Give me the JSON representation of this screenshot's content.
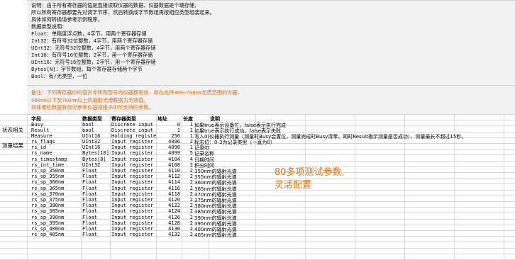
{
  "note_box": {
    "lines": [
      "说明：由于所有寄存器的值是直接读取仪器的数据，仪器数据是个端存储，",
      "所以所有寄存器都要先对调字节序，然后转换成字节数组再按相应类型组装起来。",
      "具体如何转换请参考示例程序。",
      "数据类型说明：",
      "Float：单精度浮点数，4字节，用两个寄存器存储",
      "Int32：有符号32位整数，4字节，用两个寄存器存储",
      "UInt32：无符号32位整数，4字节，用两个寄存器存储",
      "Int16：有符号16位整数，2字节，用一个寄存器存储",
      "UInt16：无符号16位整数，2字节，用一个寄存器存储",
      "Bytes[N]：字节数组，每个寄存器存储两个字节",
      "Bool：有/无类型，一位"
    ]
  },
  "warn_box": {
    "lines": [
      "备注：下列寄存器中的值并非所有型号的仪器都有效，如在支持400~700nm光谱范围的仪器，",
      "400nm以下及700nm以上的辐射光谱数据为无效值。",
      "具体哪些数据有效可参考仪器规格书中所支持的参数。"
    ]
  },
  "header": {
    "field": "字段",
    "datatype": "数据类型",
    "regtype": "寄存器类型",
    "addr": "地址",
    "length": "长度",
    "desc": "说明"
  },
  "sections": {
    "status": "状态相关",
    "measure": "测量结果"
  },
  "status_rows": [
    {
      "field": "Busy",
      "type": "bool",
      "reg": "Discrete input",
      "addr": "0",
      "len": "1",
      "desc": "如果true表示设备忙，false表示执行完成"
    },
    {
      "field": "Result",
      "type": "bool",
      "reg": "Discrete input",
      "addr": "1",
      "len": "1",
      "desc": "如果true表示执行成功，false表示失败"
    },
    {
      "field": "Measure",
      "type": "UInt16",
      "reg": "Holding registe",
      "addr": "256",
      "len": "1",
      "desc": "写入0(仪器执行测量（测量时Busy会置位，测量完成时Busy清零，同时Result指示测量是否成功），测量最长不超过15秒。"
    }
  ],
  "measure_rows": [
    {
      "field": "rs_flags",
      "type": "UInt32",
      "reg": "Input register",
      "addr": "4096",
      "len": "2",
      "desc": "标志位：0-3为记录类型（一直为0）"
    },
    {
      "field": "rs_id",
      "type": "UInt16",
      "reg": "Input register",
      "addr": "4098",
      "len": "1",
      "desc": "记录ID"
    },
    {
      "field": "rs_name",
      "type": "Bytes[10]",
      "reg": "Input register",
      "addr": "4099",
      "len": "5",
      "desc": "记录名称"
    },
    {
      "field": "rs_timestamp",
      "type": "Bytes[8]",
      "reg": "Input register",
      "addr": "4104",
      "len": "4",
      "desc": "日期时间"
    },
    {
      "field": "rs_int_time",
      "type": "UInt32",
      "reg": "Input register",
      "addr": "4108",
      "len": "2",
      "desc": "积分时间"
    },
    {
      "field": "rs_sp_350nm",
      "type": "Float",
      "reg": "Input register",
      "addr": "4110",
      "len": "2",
      "desc": "350nm的辐射光谱"
    },
    {
      "field": "rs_sp_355nm",
      "type": "Float",
      "reg": "Input register",
      "addr": "4112",
      "len": "2",
      "desc": "355nm的辐射光谱"
    },
    {
      "field": "rs_sp_360nm",
      "type": "Float",
      "reg": "Input register",
      "addr": "4114",
      "len": "2",
      "desc": "360nm的辐射光谱"
    },
    {
      "field": "rs_sp_365nm",
      "type": "Float",
      "reg": "Input register",
      "addr": "4116",
      "len": "2",
      "desc": "365nm的辐射光谱"
    },
    {
      "field": "rs_sp_370nm",
      "type": "Float",
      "reg": "Input register",
      "addr": "4118",
      "len": "2",
      "desc": "370nm的辐射光谱"
    },
    {
      "field": "rs_sp_375nm",
      "type": "Float",
      "reg": "Input register",
      "addr": "4120",
      "len": "2",
      "desc": "375nm的辐射光谱"
    },
    {
      "field": "rs_sp_380nm",
      "type": "Float",
      "reg": "Input register",
      "addr": "4122",
      "len": "2",
      "desc": "380nm的辐射光谱"
    },
    {
      "field": "rs_sp_385nm",
      "type": "Float",
      "reg": "Input register",
      "addr": "4124",
      "len": "2",
      "desc": "385nm的辐射光谱"
    },
    {
      "field": "rs_sp_390nm",
      "type": "Float",
      "reg": "Input register",
      "addr": "4126",
      "len": "2",
      "desc": "390nm的辐射光谱"
    },
    {
      "field": "rs_sp_395nm",
      "type": "Float",
      "reg": "Input register",
      "addr": "4128",
      "len": "2",
      "desc": "395nm的辐射光谱"
    },
    {
      "field": "rs_sp_400nm",
      "type": "Float",
      "reg": "Input register",
      "addr": "4130",
      "len": "2",
      "desc": "400nm的辐射光谱"
    },
    {
      "field": "rs_sp_405nm",
      "type": "Float",
      "reg": "Input register",
      "addr": "4132",
      "len": "2",
      "desc": "405nm的辐射光谱"
    }
  ],
  "annotation": [
    "80多项测试参数,",
    "灵活配置"
  ],
  "colors": {
    "note_bg": "#f2f2f2",
    "warn_text": "#e36c0a",
    "annot_text": "#e46c0a",
    "grid": "#d9d9d9"
  }
}
